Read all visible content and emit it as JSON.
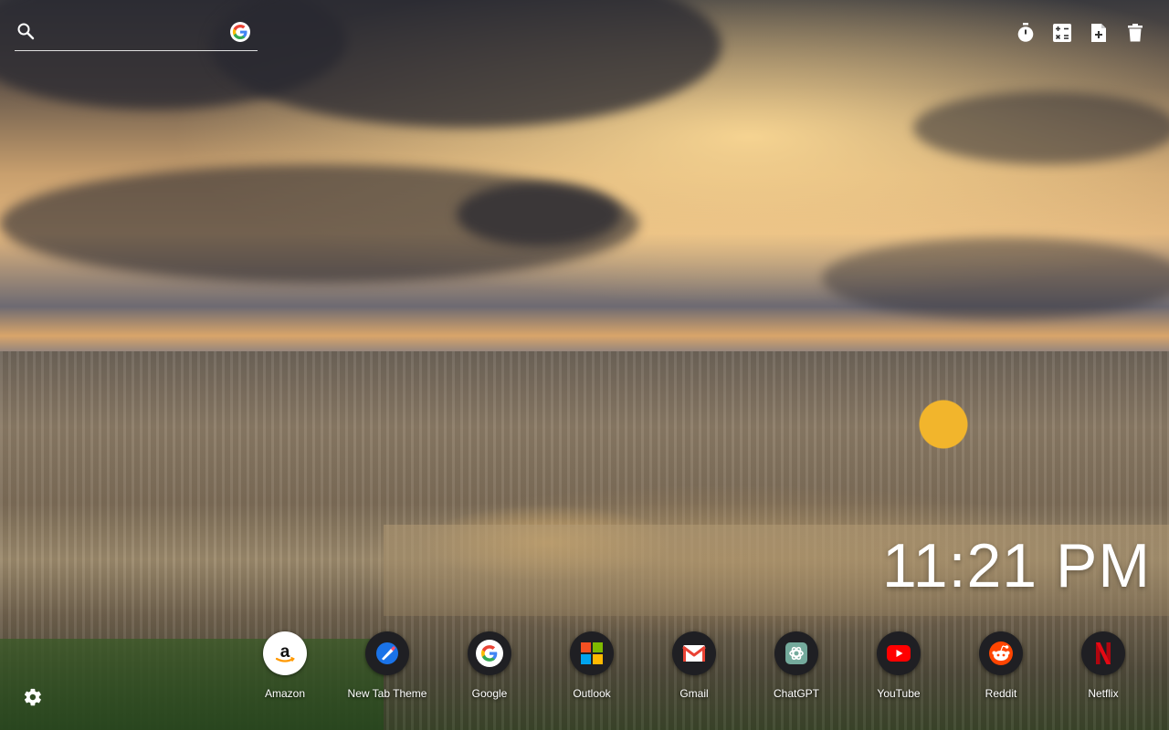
{
  "search": {
    "placeholder": "",
    "engine_icon": "google-icon"
  },
  "toolbar": {
    "icons": [
      "timer-icon",
      "calculator-icon",
      "add-note-icon",
      "trash-icon"
    ]
  },
  "clock": {
    "time": "11:21 PM"
  },
  "shortcuts": [
    {
      "label": "Amazon",
      "icon": "amazon-icon"
    },
    {
      "label": "New Tab Theme",
      "icon": "new-tab-theme-icon"
    },
    {
      "label": "Google",
      "icon": "google-icon"
    },
    {
      "label": "Outlook",
      "icon": "outlook-icon"
    },
    {
      "label": "Gmail",
      "icon": "gmail-icon"
    },
    {
      "label": "ChatGPT",
      "icon": "chatgpt-icon"
    },
    {
      "label": "YouTube",
      "icon": "youtube-icon"
    },
    {
      "label": "Reddit",
      "icon": "reddit-icon"
    },
    {
      "label": "Netflix",
      "icon": "netflix-icon"
    }
  ],
  "settings": {
    "icon": "gear-icon"
  },
  "colors": {
    "youtube": "#ff0000",
    "reddit": "#ff4500",
    "netflix": "#e50914",
    "dock_circle": "#1f1f23",
    "golden_dome": "#f2b52c"
  }
}
